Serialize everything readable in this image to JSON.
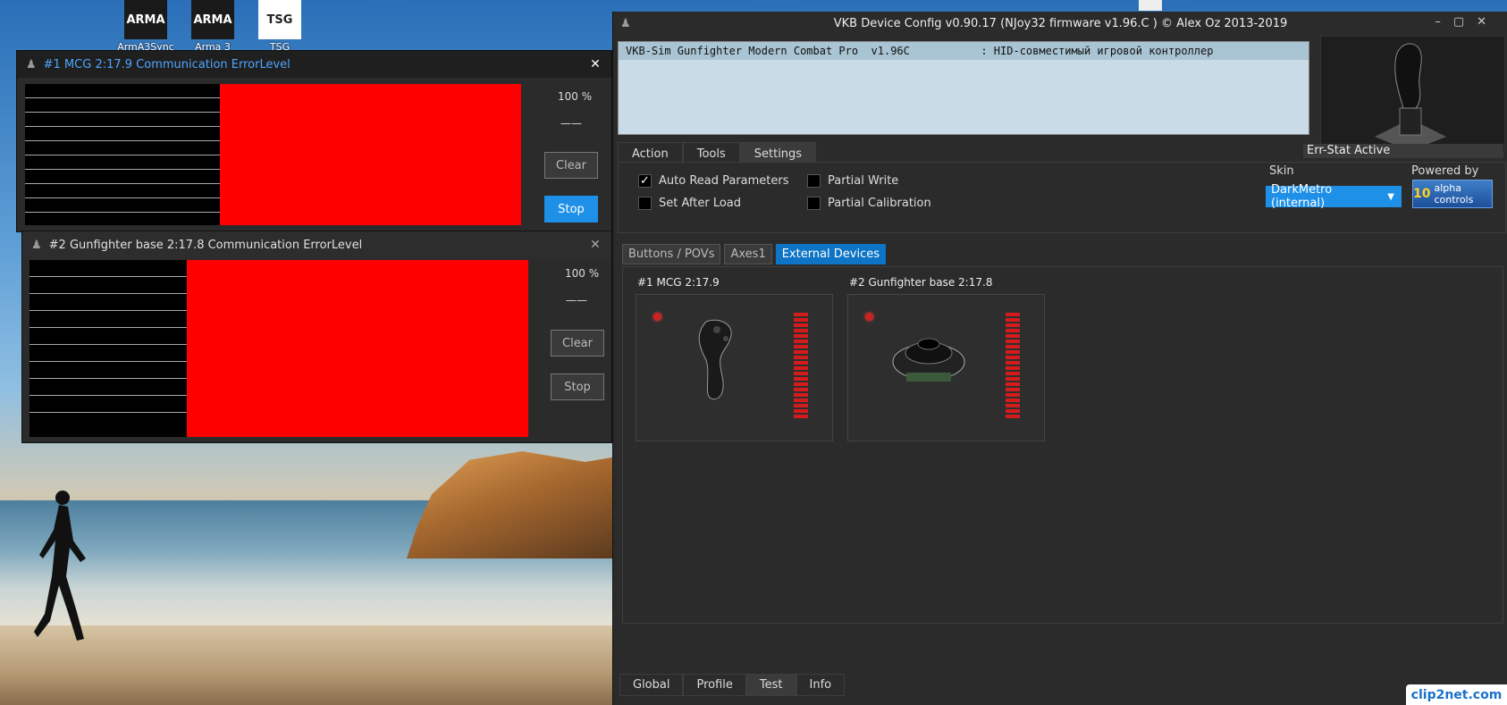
{
  "desktop": {
    "icons": [
      {
        "label": "ArmA3Sync",
        "img_text": "ARMA"
      },
      {
        "label": "Arma 3",
        "img_text": "ARMA"
      },
      {
        "label": "TSG",
        "img_text": "TSG"
      }
    ]
  },
  "monitor1": {
    "title": "#1 MCG  2:17.9  Communication ErrorLevel",
    "percent": "100 %",
    "dash": "——",
    "clear_label": "Clear",
    "stop_label": "Stop",
    "close": "✕"
  },
  "monitor2": {
    "title": "#2 Gunfighter base  2:17.8  Communication ErrorLevel",
    "percent": "100 %",
    "dash": "——",
    "clear_label": "Clear",
    "stop_label": "Stop",
    "close": "✕"
  },
  "main": {
    "title": "VKB Device Config v0.90.17 (NJoy32 firmware v1.96.C  ) © Alex Oz 2013-2019",
    "window_controls": "–▢✕",
    "device_row": "VKB-Sim Gunfighter Modern Combat Pro  v1.96C           : HID-совместимый игровой контроллер",
    "tabs": [
      "Action",
      "Tools",
      "Settings"
    ],
    "err_stat": "Err-Stat Active",
    "settings": {
      "auto_read": "Auto Read Parameters",
      "set_after_load": "Set After Load",
      "partial_write": "Partial Write",
      "partial_calibration": "Partial Calibration",
      "skin_label": "Skin",
      "skin_value": "DarkMetro (internal)",
      "powered_by": "Powered by",
      "alpha_ten": "10",
      "alpha_text": "alpha controls"
    },
    "subtabs": [
      "Buttons / POVs",
      "Axes1",
      "External Devices"
    ],
    "devices": [
      {
        "title": "#1 MCG 2:17.9"
      },
      {
        "title": "#2 Gunfighter base 2:17.8"
      }
    ],
    "bottom_tabs": [
      "Global",
      "Profile",
      "Test",
      "Info"
    ]
  },
  "watermark": "clip2net.com"
}
